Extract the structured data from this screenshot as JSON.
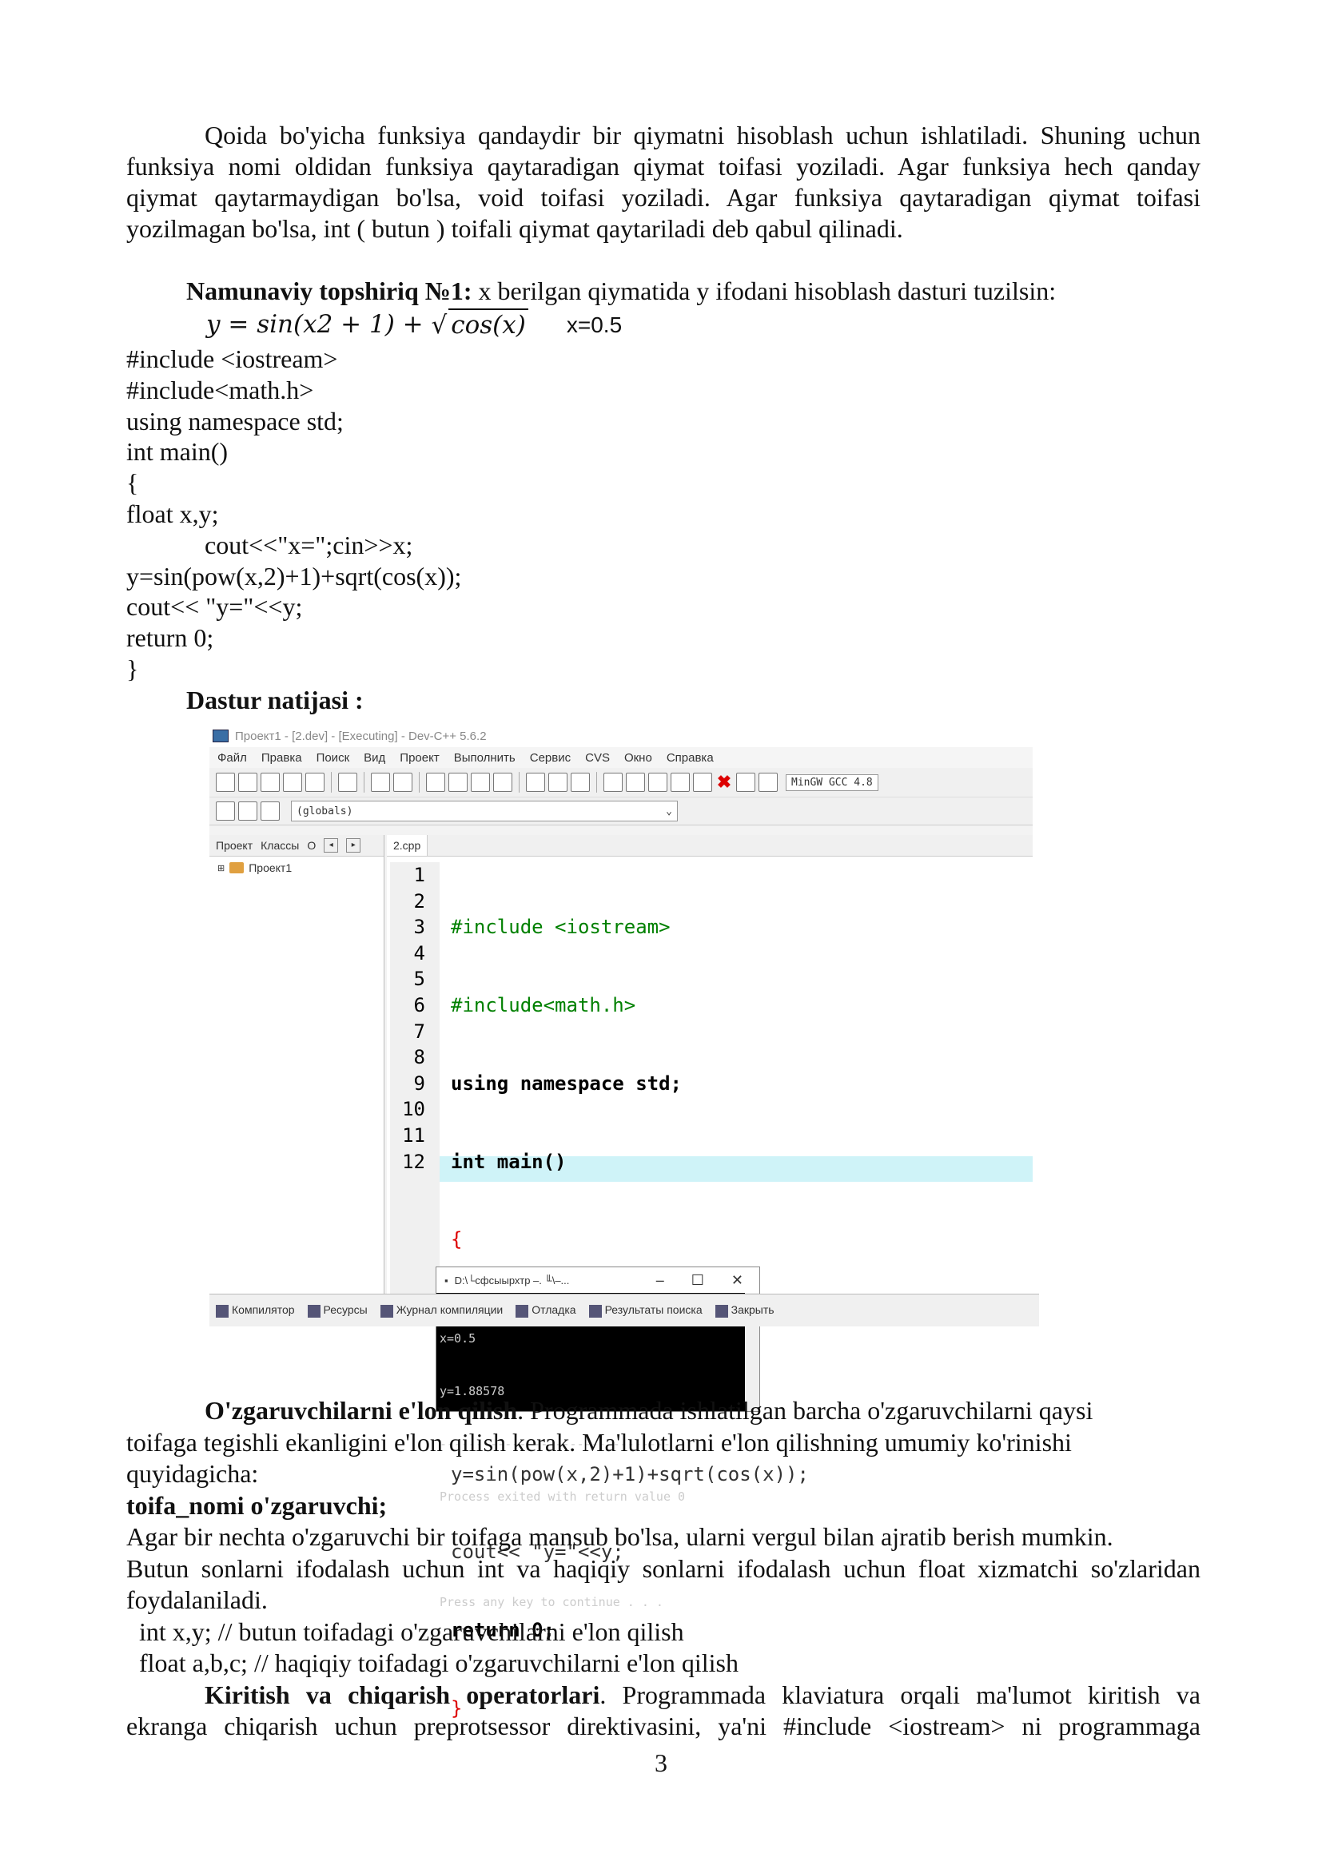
{
  "intro": {
    "lines": [
      "Qoida bo'yicha funksiya qandaydir bir qiymatni hisoblash uchun ishlatiladi. Shuning uchun",
      "funksiya nomi oldidan funksiya qaytaradigan qiymat toifasi yoziladi. Agar funksiya hech qanday",
      "qiymat qaytarmaydigan bo'lsa, void  toifasi yoziladi. Agar funksiya qaytaradigan qiymat  toifasi",
      "yozilmagan bo'lsa, int  ( butun ) toifali qiymat qaytariladi  deb qabul qilinadi."
    ]
  },
  "task": {
    "title": "Namunaviy topshiriq №1:",
    "text": " x berilgan qiymatida y ifodani hisoblash dasturi tuzilsin:",
    "formula_left": "y = sin(x",
    "formula_sup": "2",
    "formula_mid": " + 1) + ",
    "formula_sqrt": "cos(x)",
    "x_value": "x=0.5"
  },
  "code_lines": [
    "#include <iostream>",
    "#include<math.h>",
    "using namespace std;",
    "int main()",
    "{",
    "float x,y;",
    "cout<<\"x=\";cin>>x;",
    "y=sin(pow(x,2)+1)+sqrt(cos(x));",
    "cout<< \"y=\"<<y;",
    "return 0;",
    "}"
  ],
  "result_title": "Dastur natijasi :",
  "ide": {
    "window_title": "Проект1 - [2.dev] - [Executing] - Dev-C++ 5.6.2",
    "menu": [
      "Файл",
      "Правка",
      "Поиск",
      "Вид",
      "Проект",
      "Выполнить",
      "Сервис",
      "CVS",
      "Окно",
      "Справка"
    ],
    "compiler": "MinGW GCC 4.8",
    "globals": "(globals)",
    "left_tabs": [
      "Проект",
      "Классы",
      "О"
    ],
    "tree_item": "Проект1",
    "editor_tab": "2.cpp",
    "line_numbers": [
      "1",
      "2",
      "3",
      "4",
      "5",
      "6",
      "7",
      "8",
      "9",
      "10",
      "11",
      "12"
    ],
    "console_title": "D:\\└сфсыырхтр –. ╙\\–...",
    "console_lines": [
      "x=0.5",
      "y=1.88578",
      "--------------------------------",
      "Process exited with return value 0",
      "",
      "Press any key to continue . . ."
    ],
    "bottom_tabs": [
      "Компилятор",
      "Ресурсы",
      "Журнал компиляции",
      "Отладка",
      "Результаты поиска",
      "Закрыть"
    ]
  },
  "declare": {
    "heading": "O'zgaruvchilarni  e'lon qilish",
    "line1_rest": ". Programmada ishlatilgan barcha o'zgaruvchilarni qaysi",
    "line2": "toifaga tegishli ekanligini  e'lon qilish kerak. Ma'lulotlarni   e'lon qilishning  umumiy ko'rinishi",
    "line3": "quyidagicha:",
    "syntax": "toifa_nomi o'zgaruvchi;",
    "line4": "Agar bir nechta o'zgaruvchi bir toifaga mansub bo'lsa, ularni vergul bilan ajratib berish mumkin.",
    "line5": "Butun sonlarni ifodalash uchun int  va haqiqiy sonlarni ifodalash uchun float xizmatchi so'zlaridan",
    "line6": "foydalaniladi.",
    "ex1": "  int x,y; // butun toifadagi o'zgaruvchilarni e'lon qilish",
    "ex2": "  float a,b,c; // haqiqiy toifadagi o'zgaruvchilarni e'lon qilish"
  },
  "io": {
    "heading": "Kiritish  va  chiqarish  operatorlari",
    "line1_rest": ".  Programmada  klaviatura  orqali  ma'lumot  kiritish  va",
    "line2": "ekranga  chiqarish  uchun  preprotsessor  direktivasini,  ya'ni  #include  <iostream>   ni  programmaga"
  },
  "page_number": "3"
}
